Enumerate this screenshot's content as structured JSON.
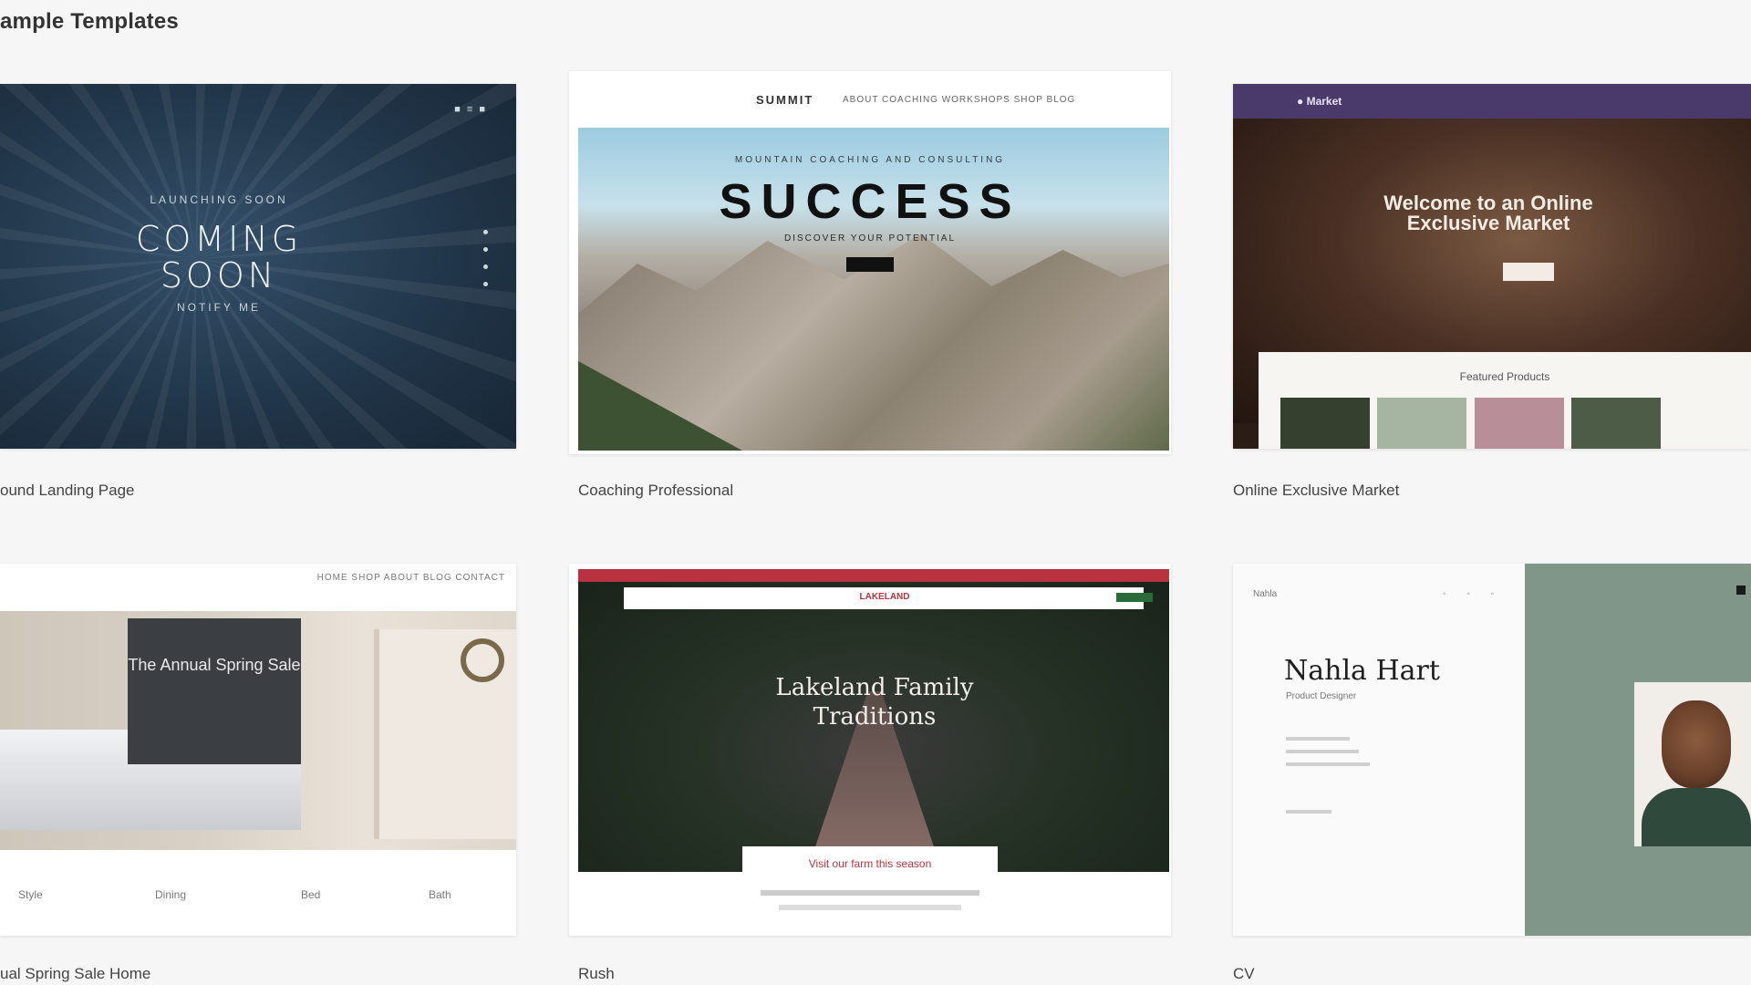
{
  "section": {
    "title": "ample Templates"
  },
  "cards": [
    {
      "caption": "ound Landing Page",
      "nav": "■  ≡  ■",
      "eyebrow": "LAUNCHING SOON",
      "headline_line1": "COMING",
      "headline_line2": "SOON",
      "subline": "NOTIFY ME"
    },
    {
      "caption": "Coaching Professional",
      "logo": "SUMMIT",
      "menu": "ABOUT   COACHING   WORKSHOPS   SHOP   BLOG",
      "eyebrow": "MOUNTAIN COACHING AND CONSULTING",
      "headline": "SUCCESS",
      "sub": "DISCOVER YOUR POTENTIAL"
    },
    {
      "caption": "Online Exclusive Market",
      "brand": "● Market",
      "headline": "Welcome to an Online Exclusive Market",
      "panel_title": "Featured Products"
    },
    {
      "caption": "ual Spring Sale Home",
      "topnav": "HOME  SHOP  ABOUT  BLOG  CONTACT",
      "overlay": "The Annual Spring Sale",
      "footer": [
        "Style",
        "Dining",
        "Bed",
        "Bath"
      ]
    },
    {
      "caption": "Rush",
      "nav_logo": "LAKELAND",
      "headline_line1": "Lakeland Family",
      "headline_line2": "Traditions",
      "footer_text": "Visit our farm this season"
    },
    {
      "caption": "CV",
      "logo": "Nahla",
      "icons": "◦ ◦ ◦",
      "name": "Nahla Hart",
      "role": "Product Designer"
    }
  ]
}
